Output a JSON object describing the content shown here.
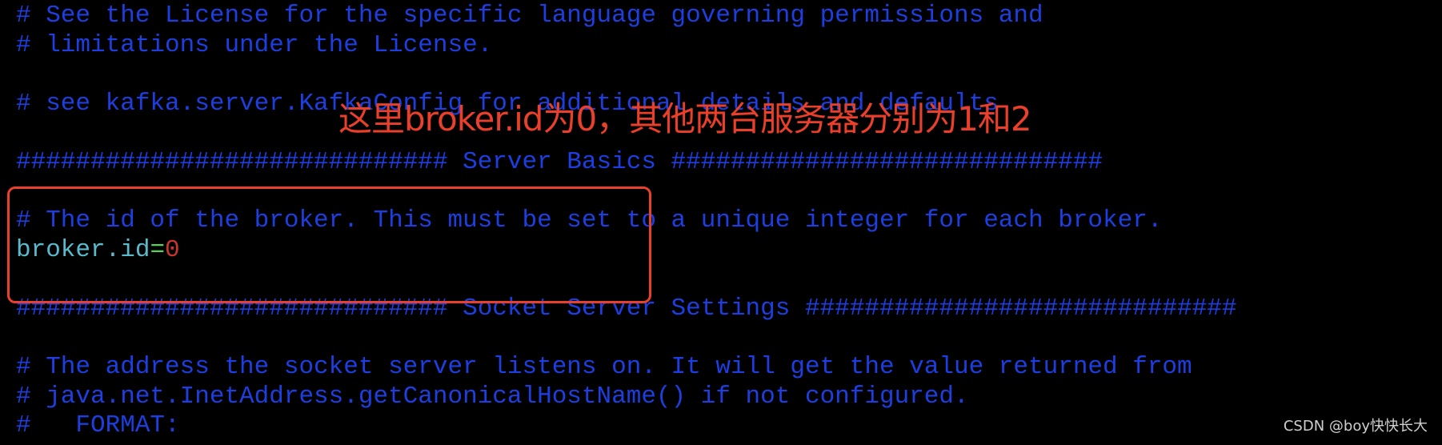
{
  "terminal": {
    "lines": [
      {
        "text": "# See the License for the specific language governing permissions and"
      },
      {
        "text": "# limitations under the License."
      },
      {
        "text": ""
      },
      {
        "text": "# see kafka.server.KafkaConfig for additional details and defaults"
      },
      {
        "text": ""
      },
      {
        "text": "############################# Server Basics #############################"
      },
      {
        "text": ""
      },
      {
        "text": "# The id of the broker. This must be set to a unique integer for each broker."
      },
      {
        "key": "broker.id",
        "eq": "=",
        "value": "0"
      },
      {
        "text": ""
      },
      {
        "text": "############################# Socket Server Settings #############################"
      },
      {
        "text": ""
      },
      {
        "text": "# The address the socket server listens on. It will get the value returned from"
      },
      {
        "text": "# java.net.InetAddress.getCanonicalHostName() if not configured."
      },
      {
        "text": "#   FORMAT:"
      }
    ]
  },
  "annotation": {
    "text": "这里broker.id为0，其他两台服务器分别为1和2",
    "color": "#ea3f2a"
  },
  "watermark": "CSDN @boy快快长大",
  "colors": {
    "comment": "#1d3ee0",
    "key": "#5ab9cc",
    "equals": "#54d354",
    "value": "#c8362c",
    "background": "#000000"
  }
}
